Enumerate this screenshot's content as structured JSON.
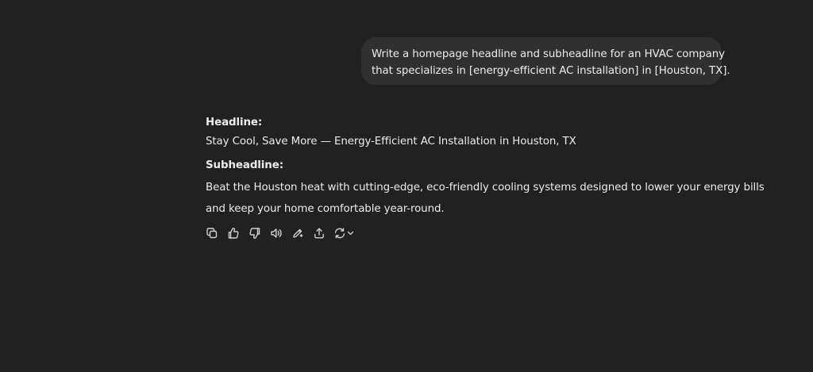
{
  "user_message": {
    "lines": [
      "Write a homepage headline and subheadline for an HVAC company",
      "that specializes in [energy-efficient AC installation] in [Houston, TX]."
    ]
  },
  "assistant_message": {
    "headline_label": "Headline:",
    "headline_text": "Stay Cool, Save More — Energy-Efficient AC Installation in Houston, TX",
    "subheadline_label": "Subheadline:",
    "subheadline_lines": [
      "Beat the Houston heat with cutting-edge, eco-friendly cooling systems designed to lower your energy bills",
      "and keep your home comfortable year-round."
    ]
  },
  "actions": [
    {
      "icon": "copy-icon"
    },
    {
      "icon": "thumbs-up-icon"
    },
    {
      "icon": "thumbs-down-icon"
    },
    {
      "icon": "read-aloud-icon"
    },
    {
      "icon": "edit-icon"
    },
    {
      "icon": "share-icon"
    },
    {
      "icon": "regenerate-icon"
    }
  ],
  "colors": {
    "background": "#212121",
    "bubble": "#303030",
    "text": "#ececec",
    "icon": "#cfcfcf"
  }
}
